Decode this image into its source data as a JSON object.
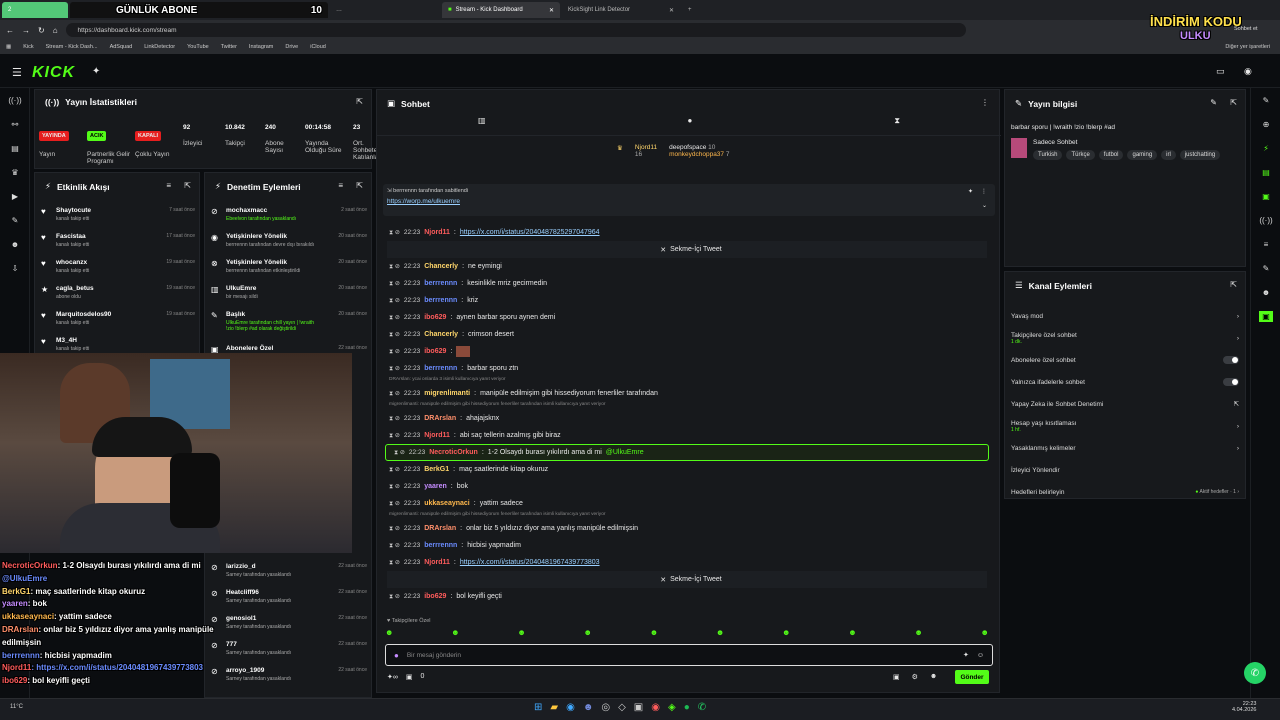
{
  "browser": {
    "tabs": [
      "GÜNLÜK ABONE",
      "10",
      "Stream - Kick Dashboard",
      "KickSight Link Detector"
    ],
    "url": "https://dashboard.kick.com/stream",
    "bookmarks": [
      "Kick",
      "Stream - Kick Dash...",
      "AdSquad",
      "LinkDetector",
      "YouTube",
      "Twitter",
      "Instagram",
      "Drive",
      "iCloud",
      "Diğer yer işaretleri"
    ]
  },
  "overlay": {
    "promo": "İNDİRİM KODU",
    "promo2": "ULKU",
    "tab_counter": "2",
    "sohbet_et": "Sohbet et"
  },
  "stats": {
    "title": "Yayın İstatistikleri",
    "badges": [
      "YAYINDA",
      "ACIK",
      "KAPALI"
    ],
    "items": [
      {
        "v": "",
        "l": "Yayın"
      },
      {
        "v": "",
        "l": "Partnerlik Gelir Programı"
      },
      {
        "v": "",
        "l": "Çoklu Yayın"
      },
      {
        "v": "92",
        "l": "İzleyici"
      },
      {
        "v": "10.842",
        "l": "Takipçi"
      },
      {
        "v": "240",
        "l": "Abone Sayısı"
      },
      {
        "v": "00:14:58",
        "l": "Yayında Olduğu Süre"
      },
      {
        "v": "23",
        "l": "Ort. Sohbete Katılanlar"
      }
    ]
  },
  "activity": {
    "title": "Etkinlik Akışı",
    "items": [
      {
        "name": "Shaytocute",
        "sub": "kanalı takip etti",
        "time": "7 saat önce"
      },
      {
        "name": "Fascistaa",
        "sub": "kanalı takip etti",
        "time": "17 saat önce"
      },
      {
        "name": "whocanzx",
        "sub": "kanalı takip etti",
        "time": "19 saat önce"
      },
      {
        "name": "cagla_betus",
        "sub": "abone oldu",
        "time": "19 saat önce"
      },
      {
        "name": "Marquitosdelos90",
        "sub": "kanalı takip etti",
        "time": "19 saat önce"
      },
      {
        "name": "M3_4H",
        "sub": "kanalı takip etti",
        "time": ""
      }
    ]
  },
  "moderation": {
    "title": "Denetim Eylemleri",
    "items": [
      {
        "name": "mochaxmacc",
        "sub": "Ebeelvon tarafından yasaklandı",
        "time": "2 saat önce"
      },
      {
        "name": "Yetişkinlere Yönelik",
        "sub": "berrrennn tarafından devre dışı bırakıldı",
        "time": "20 saat önce"
      },
      {
        "name": "Yetişkinlere Yönelik",
        "sub": "berrrennn tarafından etkinleştirildi",
        "time": "20 saat önce"
      },
      {
        "name": "UlkuEmre",
        "sub": "bir mesajı sildi",
        "time": "20 saat önce"
      },
      {
        "name": "Başlık",
        "sub": "UlkuEmre tarafından chill yayın | !wraith !zio !blerp #ad olarak değiştirildi",
        "time": "20 saat önce"
      },
      {
        "name": "Abonelere Özel",
        "sub": "",
        "time": "22 saat önce"
      }
    ],
    "lower": [
      {
        "name": "larizzio_d",
        "sub": "Sarney tarafından yasaklandı",
        "time": "22 saat önce"
      },
      {
        "name": "Heatcliff96",
        "sub": "Sarney tarafından yasaklandı",
        "time": "22 saat önce"
      },
      {
        "name": "genosiol1",
        "sub": "Sarney tarafından yasaklandı",
        "time": "22 saat önce"
      },
      {
        "name": "777",
        "sub": "Sarney tarafından yasaklandı",
        "time": "22 saat önce"
      },
      {
        "name": "arroyo_1909",
        "sub": "Sarney tarafından yasaklandı",
        "time": "22 saat önce"
      }
    ]
  },
  "chat": {
    "title": "Sohbet",
    "top_users": [
      {
        "name": "Njord11",
        "n": "16"
      },
      {
        "name": "deepofspace",
        "n": "10"
      },
      {
        "name": "monkeydchoppa37",
        "n": "7"
      }
    ],
    "pinned_by": "berrrennn tarafından sabitlendi",
    "pinned_link": "https://worp.me/ulkuemre",
    "tweet_label": "Sekme-İçi Tweet",
    "messages": [
      {
        "t": "22:23",
        "u": "Njord11",
        "c": "#ff5c5c",
        "m": "",
        "link": "https://x.com/i/status/2040487825297047964"
      },
      {
        "t": "22:23",
        "u": "Chancerly",
        "c": "#ffd66b",
        "m": "ne eymingi",
        "link": ""
      },
      {
        "t": "22:23",
        "u": "berrrennn",
        "c": "#6b8cff",
        "m": "kesinlikle mriz gecirmedin",
        "link": ""
      },
      {
        "t": "22:23",
        "u": "berrrennn",
        "c": "#6b8cff",
        "m": "kriz",
        "link": ""
      },
      {
        "t": "22:23",
        "u": "ibo629",
        "c": "#ff5c5c",
        "m": "aynen barbar sporu aynen demi",
        "link": ""
      },
      {
        "t": "22:23",
        "u": "Chancerly",
        "c": "#ffd66b",
        "m": "crimson desert",
        "link": ""
      },
      {
        "t": "22:23",
        "u": "ibo629",
        "c": "#ff5c5c",
        "m": "",
        "link": ""
      },
      {
        "t": "22:23",
        "u": "berrrennn",
        "c": "#6b8cff",
        "m": "barbar sporu ztn",
        "link": ""
      },
      {
        "t": "22:23",
        "u": "migrenlimanti",
        "c": "#ffd66b",
        "m": "manipüle edilmişim gibi hissediyorum fenerliler tarafından",
        "link": "",
        "reply": "DRArslan: ycai onlarda 3 isimli kullanıcıya yanıt veriyor"
      },
      {
        "t": "22:23",
        "u": "DRArslan",
        "c": "#ff8f6b",
        "m": "ahajajsknx",
        "link": "",
        "reply": "migrenlimanti: manipüle edilmişim gibi hissediyorum fenerliler tarafından isimli kullanıcıya yanıt veriyor"
      },
      {
        "t": "22:23",
        "u": "Njord11",
        "c": "#ff5c5c",
        "m": "abi saç tellerin azalmış gibi biraz",
        "link": ""
      },
      {
        "t": "22:23",
        "u": "NecroticOrkun",
        "c": "#ff5c5c",
        "m": "1-2 Olsaydı burası yıkılırdı ama di mi",
        "link": "",
        "mention": "@UlkuEmre",
        "hl": true
      },
      {
        "t": "22:23",
        "u": "BerkG1",
        "c": "#ffd66b",
        "m": "maç saatlerinde kitap okuruz",
        "link": ""
      },
      {
        "t": "22:23",
        "u": "yaaren",
        "c": "#c58cff",
        "m": "bok",
        "link": ""
      },
      {
        "t": "22:23",
        "u": "ukkaseaynaci",
        "c": "#ffb84d",
        "m": "yattim sadece",
        "link": ""
      },
      {
        "t": "22:23",
        "u": "DRArslan",
        "c": "#ff8f6b",
        "m": "onlar biz 5 yıldızız diyor ama yanlış manipüle edilmişsin",
        "link": "",
        "reply": "migrenlimanti: manipüle edilmişim gibi hissediyorum fenerliler tarafından isimli kullanıcıya yanıt veriyor"
      },
      {
        "t": "22:23",
        "u": "berrrennn",
        "c": "#6b8cff",
        "m": "hicbisi yapmadim",
        "link": ""
      },
      {
        "t": "22:23",
        "u": "Njord11",
        "c": "#ff5c5c",
        "m": "",
        "link": "https://x.com/i/status/2040481967439773803"
      },
      {
        "t": "22:23",
        "u": "ibo629",
        "c": "#ff5c5c",
        "m": "bol keyifli geçti",
        "link": ""
      }
    ],
    "followers_label": "Takipçilere Özel",
    "input_placeholder": "Bir mesaj gönderin",
    "send": "Gönder",
    "count": "0"
  },
  "info": {
    "title": "Yayın bilgisi",
    "stream_title": "barbar sporu | !wraith !zio !blerp #ad",
    "category": "Sadece Sohbet",
    "tags": [
      "Turkish",
      "Türkçe",
      "futbol",
      "gaming",
      "irl",
      "justchatting"
    ]
  },
  "channel": {
    "title": "Kanal Eylemleri",
    "items": [
      {
        "l": "Yavaş mod",
        "s": "",
        "k": "arrow"
      },
      {
        "l": "Takipçilere özel sohbet",
        "s": "1 dk.",
        "k": "arrow"
      },
      {
        "l": "Abonelere özel sohbet",
        "s": "",
        "k": "toggle"
      },
      {
        "l": "Yalnızca ifadelerle sohbet",
        "s": "",
        "k": "toggle"
      },
      {
        "l": "Yapay Zeka ile Sohbet Denetimi",
        "s": "",
        "k": "ext"
      },
      {
        "l": "Hesap yaşı kısıtlaması",
        "s": "1 hf.",
        "k": "arrow"
      },
      {
        "l": "Yasaklanmış kelimeler",
        "s": "",
        "k": "arrow"
      },
      {
        "l": "İzleyici Yönlendir",
        "s": "",
        "k": "none"
      },
      {
        "l": "Hedefleri belirleyin",
        "s": "Aktif hedefler · 1",
        "k": "arrow"
      }
    ]
  },
  "overlay_chat": [
    {
      "u": "NecroticOrkun",
      "m": ": 1-2 Olsaydı burası yıkılırdı ama di mi",
      "c": "#ff5c5c"
    },
    {
      "u": "@UlkuEmre",
      "m": "",
      "c": "#6b8cff"
    },
    {
      "u": "BerkG1",
      "m": ": maç saatlerinde kitap okuruz",
      "c": "#ffd66b"
    },
    {
      "u": "yaaren",
      "m": ": bok",
      "c": "#c58cff"
    },
    {
      "u": "ukkaseaynaci",
      "m": ": yattim sadece",
      "c": "#ffb84d"
    },
    {
      "u": "DRArslan",
      "m": ": onlar biz 5 yıldızız diyor ama yanlış manipüle",
      "c": "#ff8f6b"
    },
    {
      "u": "edilmişsin",
      "m": "",
      "c": "#ffffff"
    },
    {
      "u": "berrrennn",
      "m": ": hicbisi yapmadim",
      "c": "#6b8cff"
    },
    {
      "u": "Njord11",
      "m": ": https://x.com/i/status/2040481967439773803",
      "c": "#ff5c5c"
    },
    {
      "u": "ibo629",
      "m": ": bol keyifli geçti",
      "c": "#ff5c5c"
    }
  ],
  "taskbar": {
    "time": "22:23",
    "date": "4.04.2026",
    "weather": "11°C"
  }
}
